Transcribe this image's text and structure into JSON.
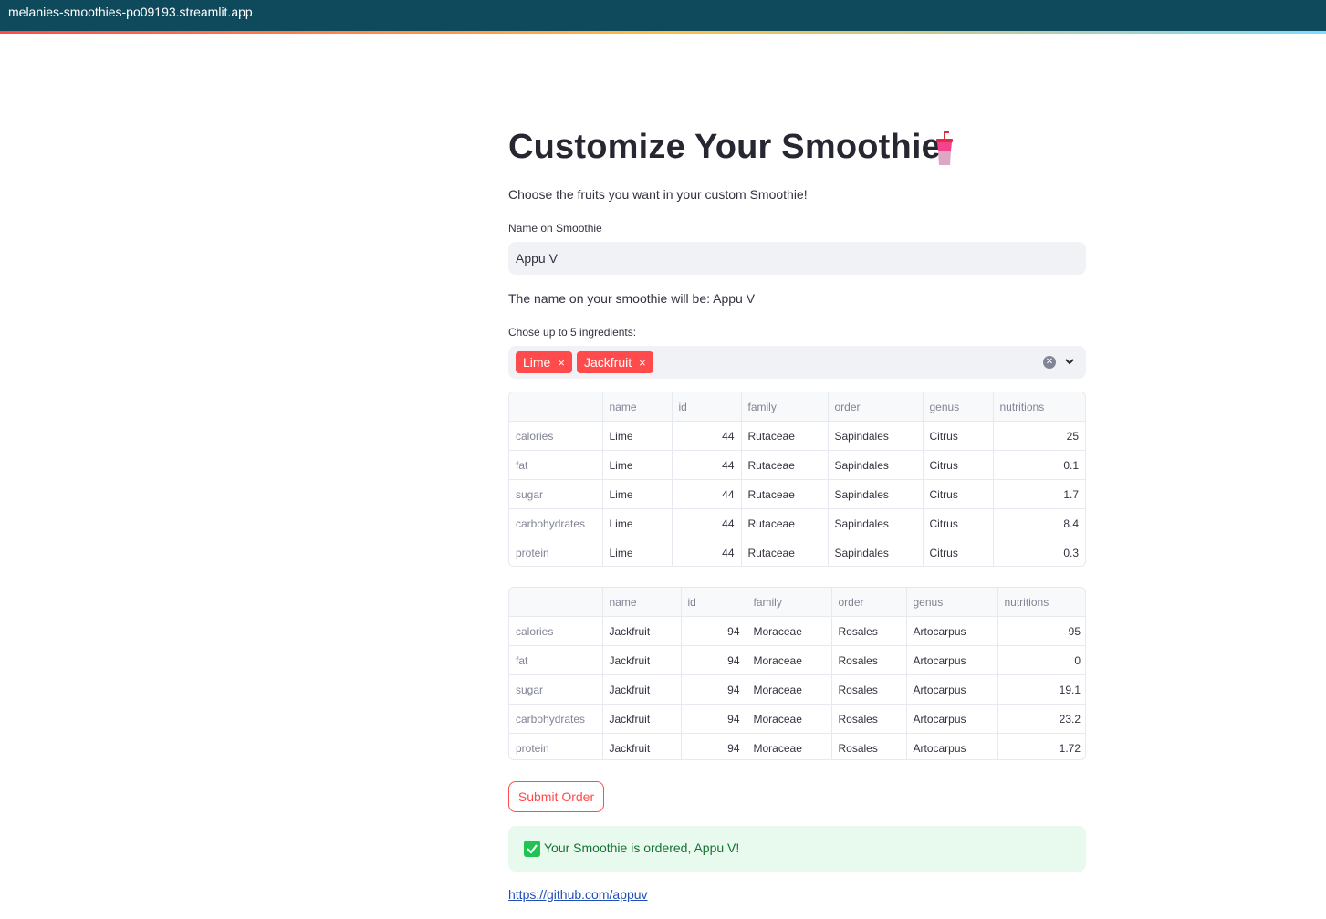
{
  "browser": {
    "url": "melanies-smoothies-po09193.streamlit.app"
  },
  "page": {
    "title": "Customize Your Smoothie",
    "title_icon": "cup-with-straw-icon",
    "caption": "Choose the fruits you want in your custom Smoothie!"
  },
  "name_input": {
    "label": "Name on Smoothie",
    "value": "Appu V"
  },
  "name_echo": "The name on your smoothie will be: Appu V",
  "ingredients": {
    "label": "Chose up to 5 ingredients:",
    "selected": [
      {
        "label": "Lime",
        "remove": "×"
      },
      {
        "label": "Jackfruit",
        "remove": "×"
      }
    ],
    "clear_icon": "clear-icon",
    "dropdown_icon": "chevron-down-icon"
  },
  "tables": [
    {
      "columns": [
        "",
        "name",
        "id",
        "family",
        "order",
        "genus",
        "nutritions"
      ],
      "rows": [
        [
          "calories",
          "Lime",
          "44",
          "Rutaceae",
          "Sapindales",
          "Citrus",
          "25"
        ],
        [
          "fat",
          "Lime",
          "44",
          "Rutaceae",
          "Sapindales",
          "Citrus",
          "0.1"
        ],
        [
          "sugar",
          "Lime",
          "44",
          "Rutaceae",
          "Sapindales",
          "Citrus",
          "1.7"
        ],
        [
          "carbohydrates",
          "Lime",
          "44",
          "Rutaceae",
          "Sapindales",
          "Citrus",
          "8.4"
        ],
        [
          "protein",
          "Lime",
          "44",
          "Rutaceae",
          "Sapindales",
          "Citrus",
          "0.3"
        ]
      ]
    },
    {
      "columns": [
        "",
        "name",
        "id",
        "family",
        "order",
        "genus",
        "nutritions"
      ],
      "rows": [
        [
          "calories",
          "Jackfruit",
          "94",
          "Moraceae",
          "Rosales",
          "Artocarpus",
          "95"
        ],
        [
          "fat",
          "Jackfruit",
          "94",
          "Moraceae",
          "Rosales",
          "Artocarpus",
          "0"
        ],
        [
          "sugar",
          "Jackfruit",
          "94",
          "Moraceae",
          "Rosales",
          "Artocarpus",
          "19.1"
        ],
        [
          "carbohydrates",
          "Jackfruit",
          "94",
          "Moraceae",
          "Rosales",
          "Artocarpus",
          "23.2"
        ],
        [
          "protein",
          "Jackfruit",
          "94",
          "Moraceae",
          "Rosales",
          "Artocarpus",
          "1.72"
        ]
      ]
    }
  ],
  "submit_label": "Submit Order",
  "success_message": "Your Smoothie is ordered, Appu V!",
  "footer_link": "https://github.com/appuv",
  "colors": {
    "primary": "#ff4b4b",
    "topbar": "#0f4a5c",
    "success_bg": "#e8f9ee",
    "success_text": "#177233",
    "input_bg": "#f0f2f6"
  }
}
